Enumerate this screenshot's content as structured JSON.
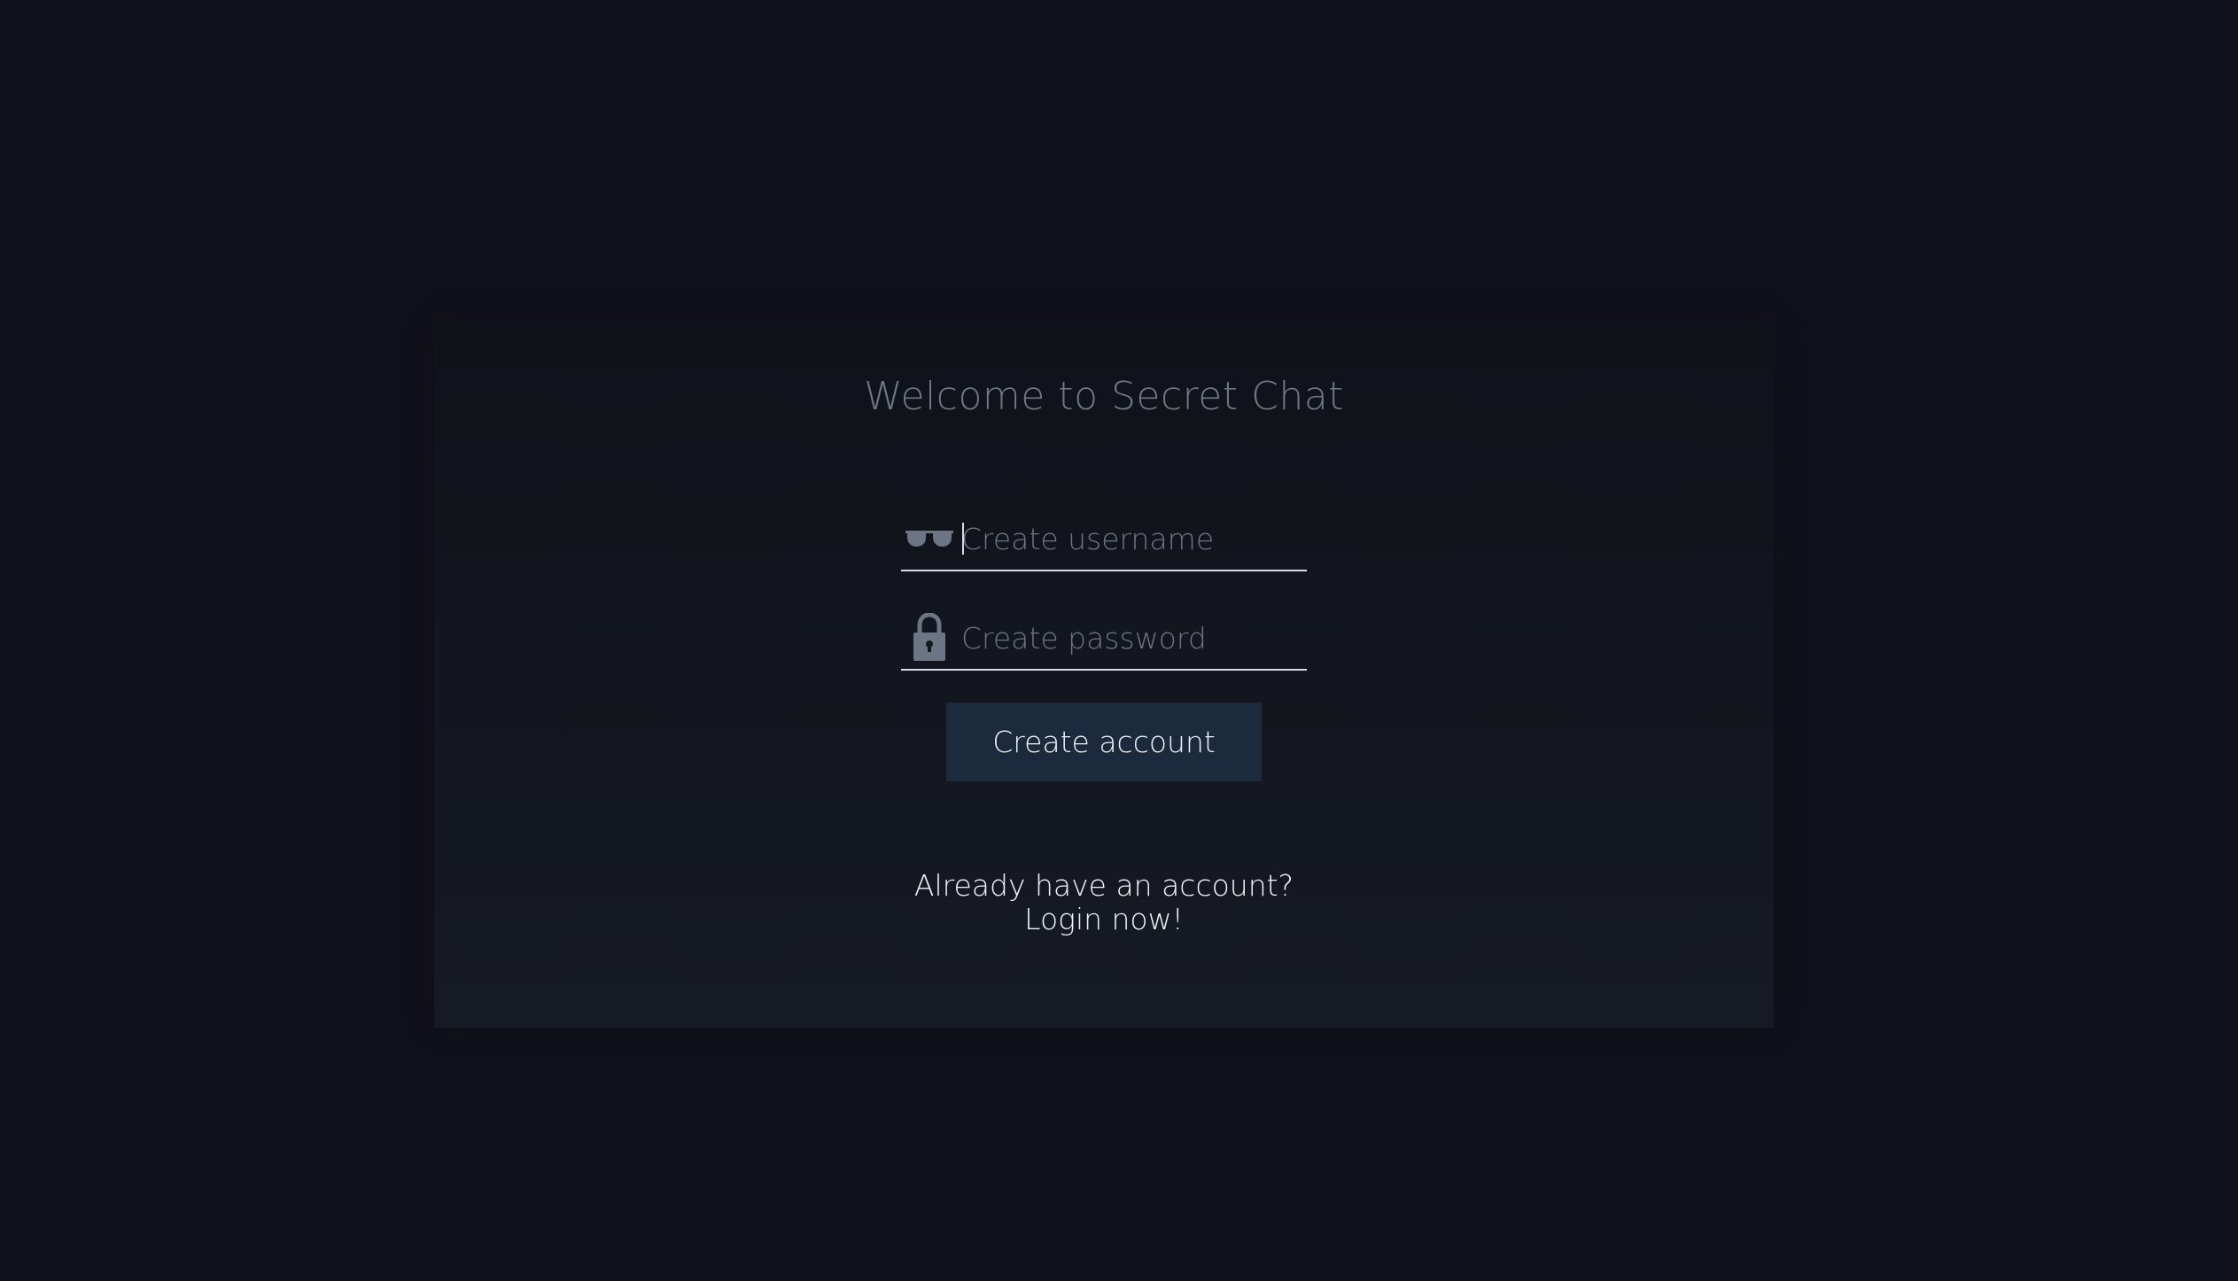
{
  "page": {
    "title": "Welcome to Secret Chat"
  },
  "form": {
    "username": {
      "placeholder": "Create username",
      "value": "",
      "icon": "glasses-icon"
    },
    "password": {
      "placeholder": "Create password",
      "value": "",
      "icon": "lock-icon"
    },
    "submit_label": "Create account"
  },
  "footer": {
    "line1": "Already have an account?",
    "line2": "Login now!"
  },
  "colors": {
    "background": "#10111a",
    "card_top": "#10121a",
    "card_bottom": "#161a22",
    "title": "#6e7887",
    "placeholder": "#6b7584",
    "underline": "#d8dce3",
    "button": "#1c2a3d",
    "button_text": "#eef1f5",
    "footer_text": "#f2f4f7"
  }
}
